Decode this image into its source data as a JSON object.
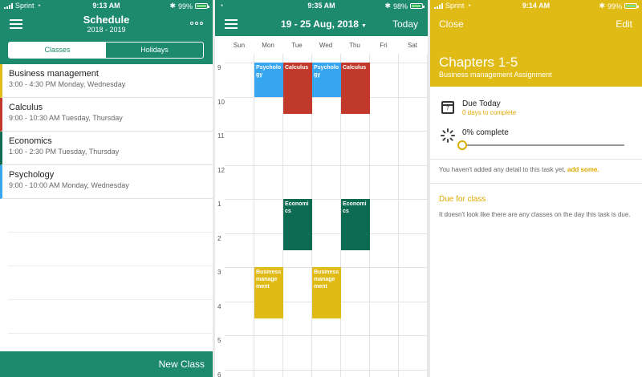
{
  "colors": {
    "primary": "#1d8a6e",
    "business": "#e0bb15",
    "calculus": "#c0392b",
    "economics": "#0d6b52",
    "psychology": "#36a6f0",
    "accent": "#e0a800"
  },
  "screens": [
    {
      "status": {
        "carrier": "Sprint",
        "time": "9:13 AM",
        "battery": "99%"
      },
      "title": "Schedule",
      "subtitle": "2018 - 2019",
      "more_icon": "more-icon",
      "tabs": [
        {
          "label": "Classes",
          "active": true
        },
        {
          "label": "Holidays",
          "active": false
        }
      ],
      "classes": [
        {
          "name": "Business management",
          "time": "3:00 - 4:30 PM Monday, Wednesday",
          "color": "#e0bb15"
        },
        {
          "name": "Calculus",
          "time": "9:00 - 10:30 AM Tuesday, Thursday",
          "color": "#c0392b"
        },
        {
          "name": "Economics",
          "time": "1:00 - 2:30 PM Tuesday, Thursday",
          "color": "#0d6b52"
        },
        {
          "name": "Psychology",
          "time": "9:00 - 10:00 AM Monday, Wednesday",
          "color": "#36a6f0"
        }
      ],
      "new_class": "New Class"
    },
    {
      "status": {
        "carrier": "",
        "time": "9:35 AM",
        "battery": "98%"
      },
      "date_range": "19 - 25 Aug, 2018",
      "today": "Today",
      "days": [
        "Sun",
        "Mon",
        "Tue",
        "Wed",
        "Thu",
        "Fri",
        "Sat"
      ],
      "hours": [
        "9",
        "10",
        "11",
        "12",
        "1",
        "2",
        "3",
        "4",
        "5",
        "6"
      ],
      "events": [
        {
          "label": "Psychology",
          "day": 1,
          "start": 9,
          "end": 10,
          "color": "#36a6f0"
        },
        {
          "label": "Calculus",
          "day": 2,
          "start": 9,
          "end": 10.5,
          "color": "#c0392b"
        },
        {
          "label": "Psychology",
          "day": 3,
          "start": 9,
          "end": 10,
          "color": "#36a6f0"
        },
        {
          "label": "Calculus",
          "day": 4,
          "start": 9,
          "end": 10.5,
          "color": "#c0392b"
        },
        {
          "label": "Economics",
          "day": 2,
          "start": 13,
          "end": 14.5,
          "color": "#0d6b52"
        },
        {
          "label": "Economics",
          "day": 4,
          "start": 13,
          "end": 14.5,
          "color": "#0d6b52"
        },
        {
          "label": "Business management",
          "day": 1,
          "start": 15,
          "end": 16.5,
          "color": "#e0bb15"
        },
        {
          "label": "Business management",
          "day": 3,
          "start": 15,
          "end": 16.5,
          "color": "#e0bb15"
        }
      ]
    },
    {
      "status": {
        "carrier": "Sprint",
        "time": "9:14 AM",
        "battery": "99%"
      },
      "close": "Close",
      "edit": "Edit",
      "task_title": "Chapters 1-5",
      "task_subtitle": "Business management  Assignment",
      "due_title": "Due Today",
      "due_sub": "0 days to complete",
      "calendar_day": "7",
      "progress_label": "0% complete",
      "progress": 0,
      "no_detail": "You haven't added any detail to this task yet,",
      "add_some": "add some.",
      "due_for_class": "Due for class",
      "no_classes": "It doesn't look like there are any classes on the day this task is due."
    }
  ]
}
